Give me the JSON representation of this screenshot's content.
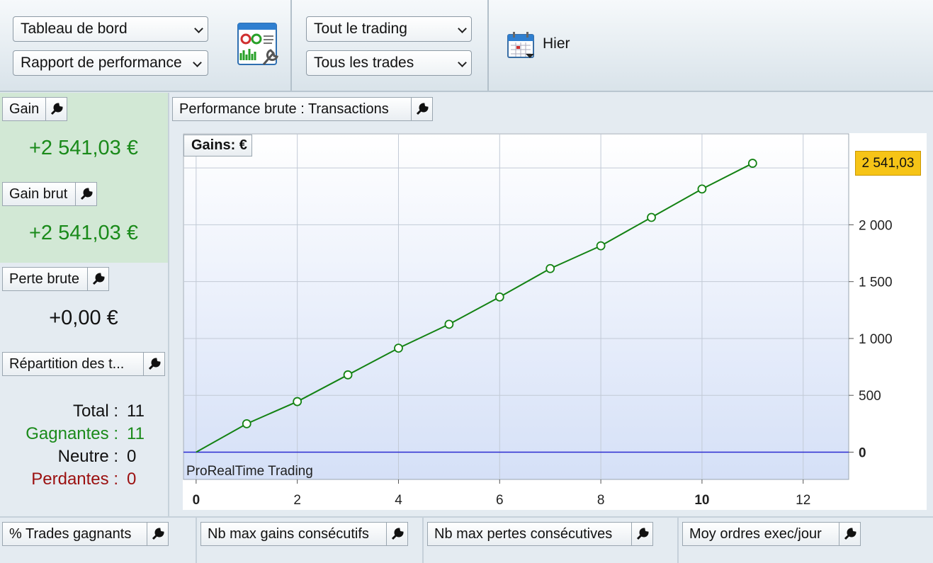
{
  "toolbar": {
    "dashboard_select": "Tableau de bord",
    "report_select": "Rapport de performance",
    "trading_select": "Tout le trading",
    "trades_select": "Tous les trades",
    "date_label": "Hier",
    "report_icon": "report-settings-icon",
    "calendar_icon": "calendar-icon"
  },
  "widgets": {
    "gain": {
      "label": "Gain",
      "value": "+2 541,03 €"
    },
    "gross_gain": {
      "label": "Gain brut",
      "value": "+2 541,03 €"
    },
    "gross_loss": {
      "label": "Perte brute",
      "value": "+0,00 €"
    },
    "distribution": {
      "label": "Répartition des t...",
      "rows": [
        {
          "key": "Total :",
          "value": "11",
          "color": "#111111"
        },
        {
          "key": "Gagnantes :",
          "value": "11",
          "color": "#1a8a1a"
        },
        {
          "key": "Neutre :",
          "value": "0",
          "color": "#111111"
        },
        {
          "key": "Perdantes :",
          "value": "0",
          "color": "#9b1010"
        }
      ]
    }
  },
  "chart": {
    "title": "Performance brute : Transactions",
    "badge": "Gains: €",
    "last_value_label": "2 541,03",
    "watermark": "ProRealTime Trading"
  },
  "chart_data": {
    "type": "line",
    "title": "Performance brute : Transactions",
    "ylabel": "Gains: €",
    "x": [
      0,
      1,
      2,
      3,
      4,
      5,
      6,
      7,
      8,
      9,
      10,
      11
    ],
    "series": [
      {
        "values": [
          0,
          250,
          445,
          680,
          915,
          1125,
          1365,
          1615,
          1815,
          2065,
          2315,
          2541.03
        ]
      }
    ],
    "x_ticks": [
      "0",
      "2",
      "4",
      "6",
      "8",
      "10",
      "12"
    ],
    "y_ticks": [
      "0",
      "500",
      "1 000",
      "1 500",
      "2 000"
    ],
    "xlim": [
      -0.25,
      12.9
    ],
    "ylim": [
      -240,
      2800
    ],
    "grid": true,
    "line_color": "#138213",
    "zero_line_color": "#2a2ad0"
  },
  "bottom": {
    "win_pct": "% Trades gagnants",
    "max_consec_gains": "Nb max gains consécutifs",
    "max_consec_losses": "Nb max pertes consécutives",
    "avg_orders": "Moy ordres exec/jour"
  }
}
